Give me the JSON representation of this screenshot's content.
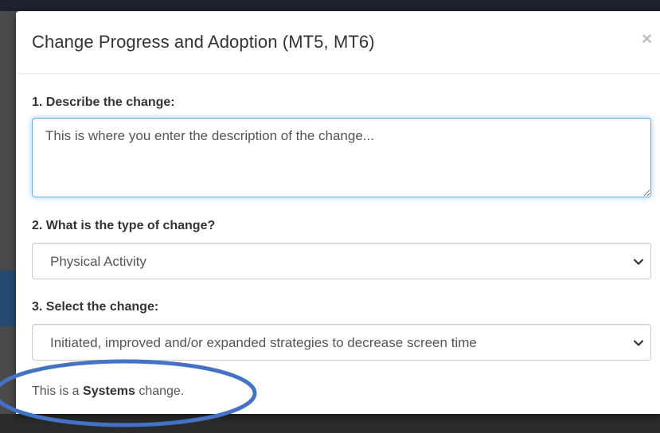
{
  "modal": {
    "title": "Change Progress and Adoption (MT5, MT6)",
    "close_symbol": "×",
    "close_icon": "close-icon"
  },
  "form": {
    "q1_label": "1. Describe the change:",
    "q1_value": "This is where you enter the description of the change...",
    "q2_label": "2. What is the type of change?",
    "q2_selected": "Physical Activity",
    "q3_label": "3. Select the change:",
    "q3_selected": "Initiated, improved and/or expanded strategies to decrease screen time"
  },
  "note": {
    "prefix": "This is a",
    "emphasis": "Systems",
    "suffix": "change."
  },
  "colors": {
    "focus_border": "#66afe9",
    "annotation_ellipse": "#4472c4",
    "backdrop": "#4a4a4a"
  }
}
